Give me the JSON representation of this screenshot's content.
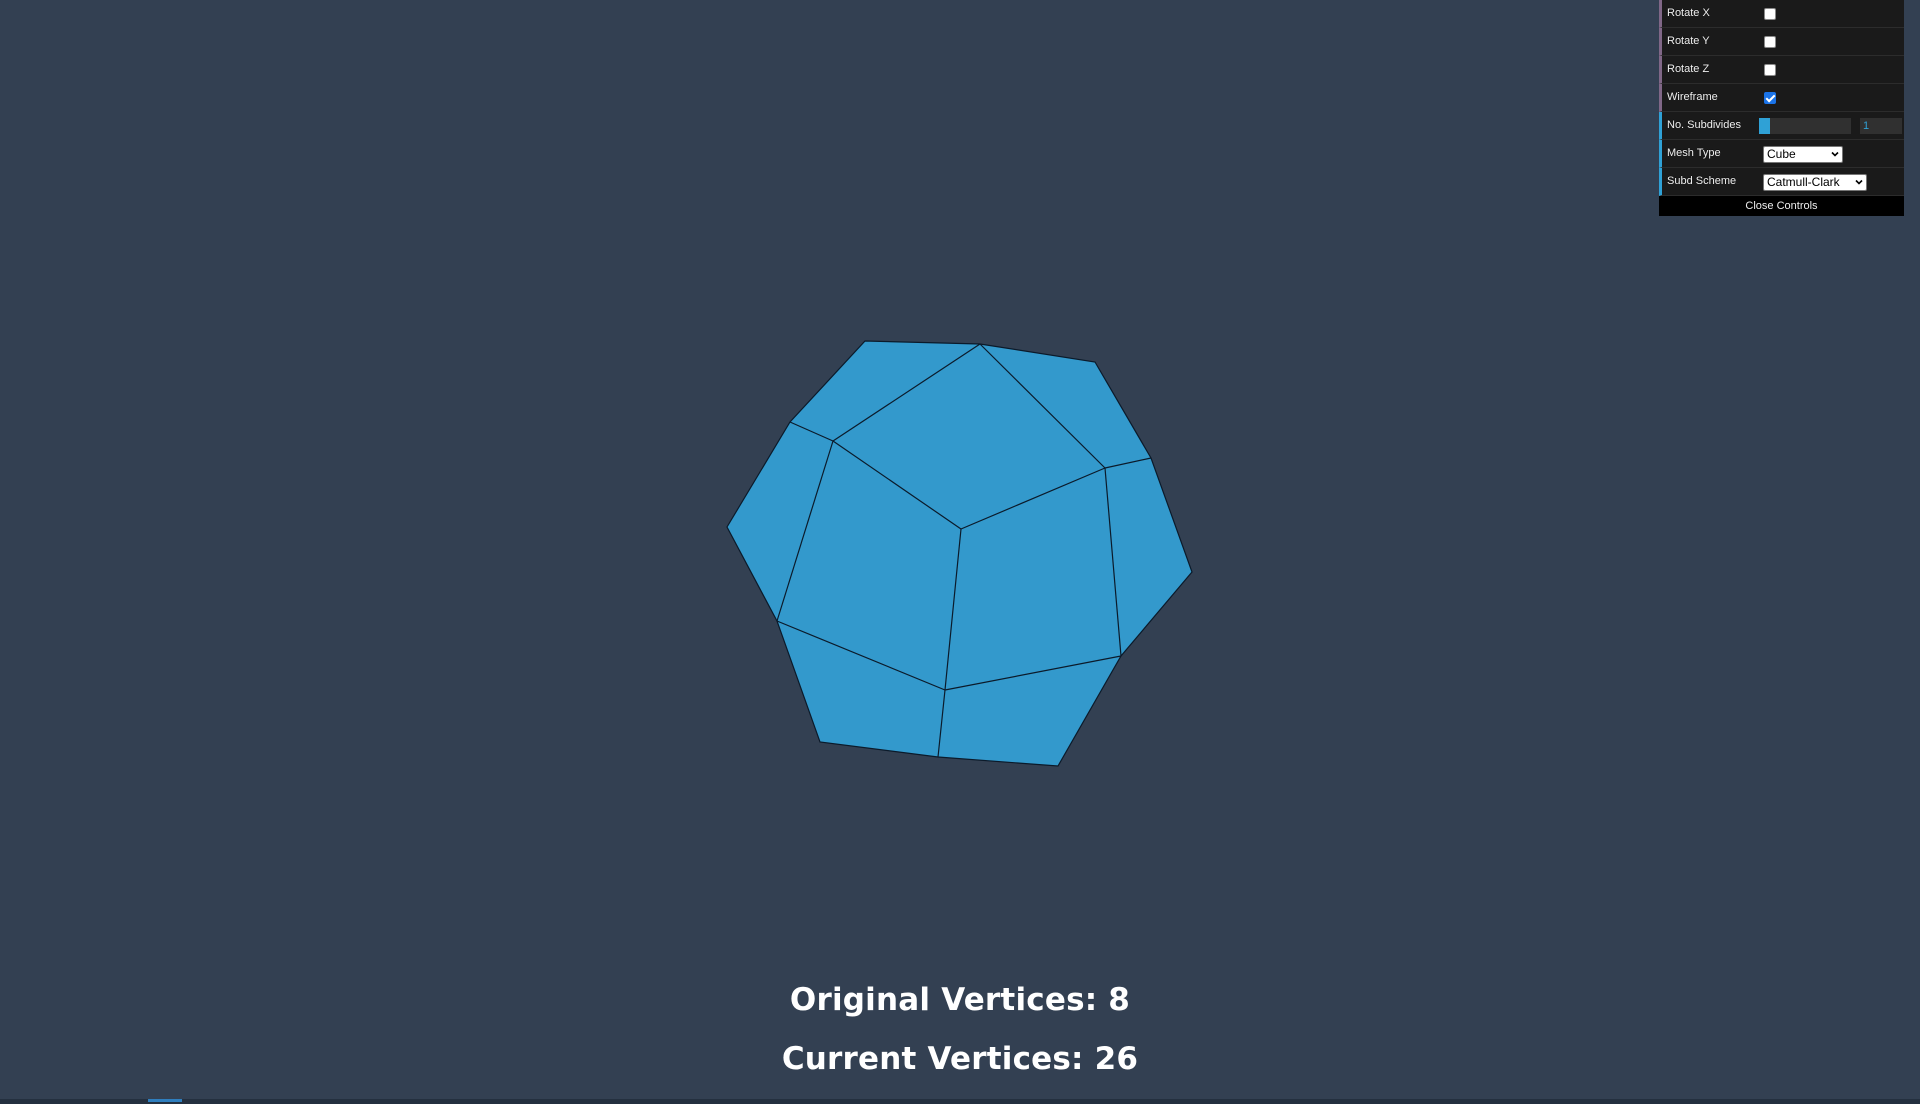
{
  "scene": {
    "background": "#334052",
    "mesh_fill": "#3399cc",
    "edge_color": "#0b1a2a"
  },
  "stats": {
    "original_vertices": "Original Vertices: 8",
    "current_vertices": "Current Vertices: 26"
  },
  "gui": {
    "rotate_x": {
      "label": "Rotate X",
      "checked": false
    },
    "rotate_y": {
      "label": "Rotate Y",
      "checked": false
    },
    "rotate_z": {
      "label": "Rotate Z",
      "checked": false
    },
    "wireframe": {
      "label": "Wireframe",
      "checked": true
    },
    "subdivides": {
      "label": "No. Subdivides",
      "value": "1",
      "fraction": 0.12
    },
    "mesh_type": {
      "label": "Mesh Type",
      "selected": "Cube"
    },
    "subd_scheme": {
      "label": "Subd Scheme",
      "selected": "Catmull-Clark"
    },
    "close_label": "Close Controls",
    "accent": "#2fa1d6",
    "bool_accent": "#806787"
  }
}
